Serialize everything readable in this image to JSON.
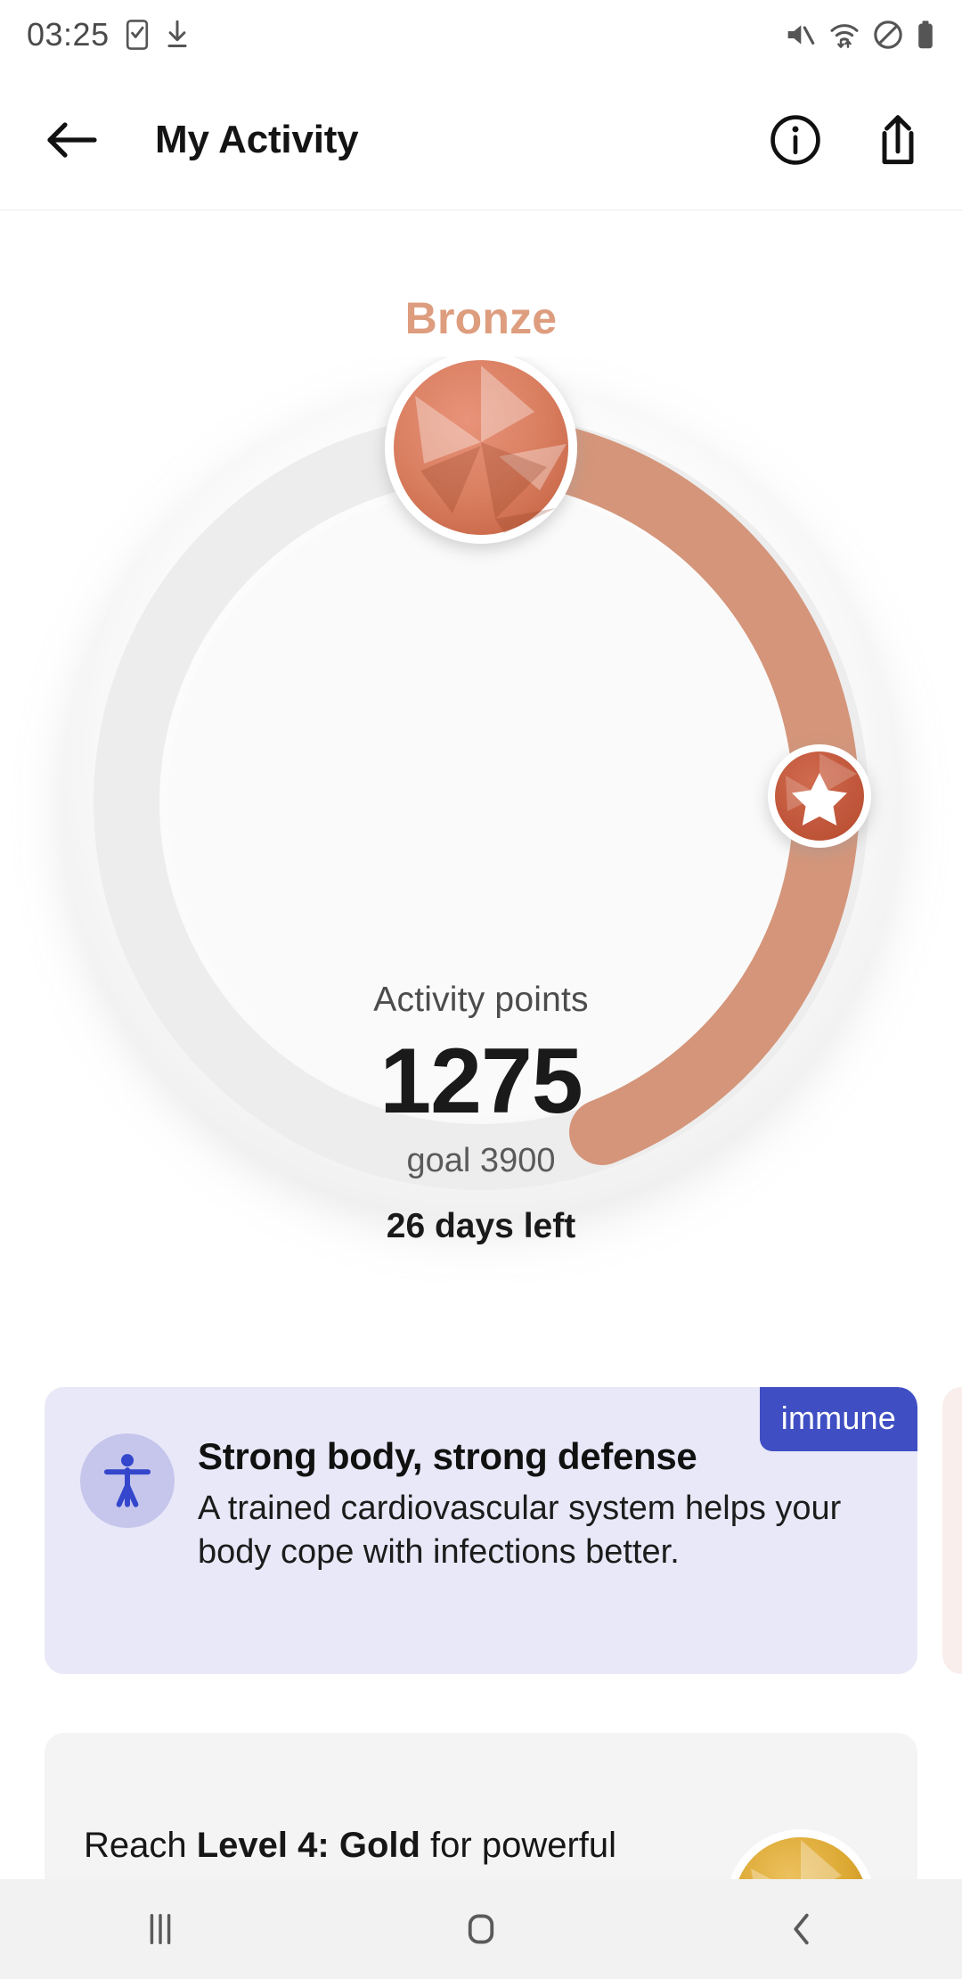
{
  "status_bar": {
    "time": "03:25",
    "left_icons": [
      "checklist-phone-icon",
      "download-icon"
    ],
    "right_icons": [
      "mute-icon",
      "wifi-data-icon",
      "do-not-disturb-icon",
      "battery-icon"
    ]
  },
  "app_bar": {
    "back_icon": "back-arrow-icon",
    "title": "My Activity",
    "info_icon": "info-icon",
    "share_icon": "share-icon"
  },
  "activity": {
    "level_label": "Bronze",
    "level_color": "#dd9d7e",
    "points_label": "Activity points",
    "points_value": "1275",
    "goal_text": "goal 3900",
    "days_left": "26 days left",
    "progress_percent": 33,
    "gem_icon": "bronze-gem-icon",
    "star_marker_icon": "star-milestone-icon",
    "track_color": "#ededed",
    "arc_color": "#d4957a"
  },
  "info_card": {
    "badge": "immune",
    "badge_color": "#3f4fc3",
    "background_color": "#e8e8f8",
    "icon": "accessibility-person-icon",
    "title": "Strong body, strong defense",
    "description": "A trained cardiovascular system helps your body cope with infections better."
  },
  "peek_card": {
    "background_color": "#f9eeec"
  },
  "next_level_card": {
    "text_before": "Reach ",
    "text_bold": "Level 4: Gold",
    "text_after": " for powerful",
    "gem_icon": "gold-gem-icon",
    "background_color": "#f4f4f4"
  },
  "nav_bar": {
    "recents_label": "recents-icon",
    "home_label": "home-icon",
    "back_label": "back-icon"
  }
}
